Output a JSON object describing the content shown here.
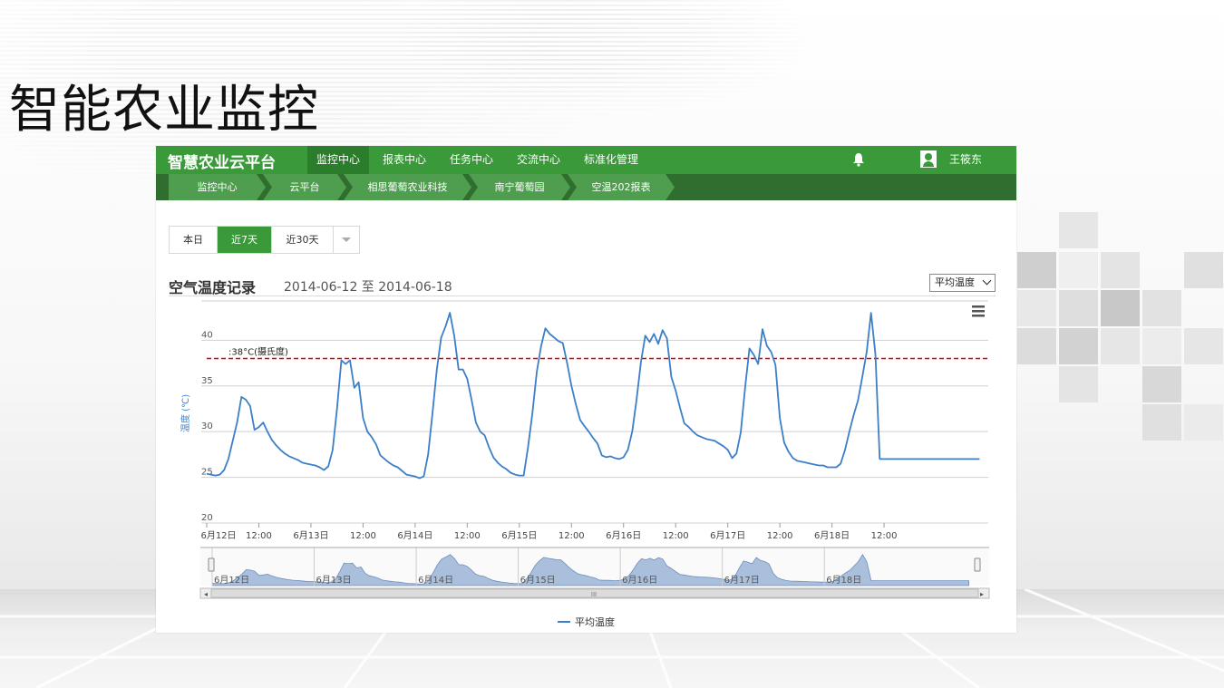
{
  "slide": {
    "title": "智能农业监控"
  },
  "app": {
    "brand": "智慧农业云平台",
    "nav": [
      "监控中心",
      "报表中心",
      "任务中心",
      "交流中心",
      "标准化管理"
    ],
    "nav_active": 0,
    "user": "王筱东",
    "breadcrumbs": [
      "监控中心",
      "云平台",
      "相思葡萄农业科技",
      "南宁葡萄园",
      "空温202报表"
    ],
    "ranges": [
      "本日",
      "近7天",
      "近30天"
    ],
    "range_active": 1,
    "chart_title": "空气温度记录",
    "chart_range": "2014-06-12 至 2014-06-18",
    "metric_select": "平均温度",
    "colors": {
      "nav_green": "#3a9a3a",
      "crumb_dark": "#2f6e2f",
      "line": "#3c7fc8",
      "threshold": "#e00000",
      "navigator_fill": "#a9bfdc"
    }
  },
  "chart_data": {
    "type": "line",
    "ylabel": "温度 (℃)",
    "ylim": [
      20,
      44
    ],
    "yticks": [
      20,
      25,
      30,
      35,
      40
    ],
    "xticks": [
      "6月12日",
      "12:00",
      "6月13日",
      "12:00",
      "6月14日",
      "12:00",
      "6月15日",
      "12:00",
      "6月16日",
      "12:00",
      "6月17日",
      "12:00",
      "6月18日",
      "12:00"
    ],
    "threshold": {
      "value": 38,
      "label": ":38°C(摄氏度)"
    },
    "legend": "平均温度",
    "navigator_labels": [
      "6月12日",
      "6月13日",
      "6月14日",
      "6月15日",
      "6月16日",
      "6月17日",
      "6月18日"
    ],
    "series": [
      {
        "name": "平均温度",
        "hours": [
          0,
          1,
          2,
          3,
          4,
          5,
          6,
          7,
          8,
          9,
          10,
          11,
          12,
          13,
          14,
          15,
          16,
          17,
          18,
          19,
          20,
          21,
          22,
          23,
          24,
          25,
          26,
          27,
          28,
          29,
          30,
          31,
          32,
          33,
          34,
          35,
          36,
          37,
          38,
          39,
          40,
          41,
          42,
          43,
          44,
          45,
          46,
          47,
          48,
          49,
          50,
          51,
          52,
          53,
          54,
          55,
          56,
          57,
          58,
          59,
          60,
          61,
          62,
          63,
          64,
          65,
          66,
          67,
          68,
          69,
          70,
          71,
          72,
          73,
          74,
          75,
          76,
          77,
          78,
          79,
          80,
          81,
          82,
          83,
          84,
          85,
          86,
          87,
          88,
          89,
          90,
          91,
          92,
          93,
          94,
          95,
          96,
          97,
          98,
          99,
          100,
          101,
          102,
          103,
          104,
          105,
          106,
          107,
          108,
          109,
          110,
          111,
          112,
          113,
          114,
          115,
          116,
          117,
          118,
          119,
          120,
          121,
          122,
          123,
          124,
          125,
          126,
          127,
          128,
          129,
          130,
          131,
          132,
          133,
          134,
          135,
          136,
          137,
          138,
          139,
          140,
          141,
          142,
          143,
          144,
          145,
          146,
          147,
          148,
          149,
          150,
          151,
          152,
          153,
          154,
          155,
          156,
          157,
          158,
          159,
          160,
          161,
          162,
          163,
          164,
          165,
          166,
          167,
          168,
          169,
          170,
          171,
          172,
          173,
          174,
          175,
          176,
          177,
          178,
          179
        ],
        "values": [
          25.4,
          25.3,
          25.2,
          25.3,
          25.8,
          27,
          29,
          31,
          33.8,
          33.5,
          32.8,
          30.2,
          30.5,
          31,
          30,
          29.1,
          28.5,
          28,
          27.6,
          27.3,
          27.1,
          26.9,
          26.6,
          26.5,
          26.4,
          26.3,
          26.1,
          25.8,
          26.2,
          28,
          32.5,
          37.8,
          37.4,
          37.8,
          34.8,
          35.4,
          31.5,
          30,
          29.4,
          28.6,
          27.4,
          27,
          26.6,
          26.3,
          26.1,
          25.7,
          25.3,
          25.2,
          25.1,
          24.9,
          25.1,
          27.5,
          32,
          36.8,
          40.3,
          41.5,
          43,
          40.5,
          36.8,
          36.8,
          35.8,
          33.5,
          31,
          30,
          29.6,
          28.3,
          27.2,
          26.6,
          26.2,
          25.9,
          25.5,
          25.3,
          25.2,
          25.2,
          28.3,
          32,
          36.5,
          39.3,
          41.3,
          40.7,
          40.3,
          39.9,
          39.7,
          37.5,
          35,
          33,
          31.3,
          30.6,
          30,
          29.3,
          28.7,
          27.4,
          27.2,
          27.3,
          27.1,
          27,
          27.2,
          28,
          30,
          33.5,
          37.6,
          40.5,
          39.8,
          40.7,
          39.6,
          41.1,
          40.2,
          36,
          34.5,
          32.6,
          30.9,
          30.5,
          30,
          29.6,
          29.4,
          29.2,
          29.1,
          29,
          28.7,
          28.4,
          28,
          27.1,
          27.6,
          29.9,
          34.8,
          39.1,
          38.4,
          37.4,
          41.2,
          39.4,
          38.7,
          37.3,
          31.5,
          28.8,
          27.8,
          27.1,
          26.8,
          26.7,
          26.6,
          26.5,
          26.4,
          26.3,
          26.3,
          26.1,
          26.1,
          26.1,
          26.5,
          28,
          30,
          31.8,
          33.4,
          36,
          38.7,
          43,
          38.5,
          27,
          27,
          27,
          27,
          27,
          27,
          27,
          27,
          27,
          27,
          27,
          27,
          27,
          27,
          27,
          27,
          27,
          27,
          27,
          27,
          27,
          27,
          27,
          27,
          27,
          27,
          27,
          27,
          27,
          27,
          27,
          27,
          27
        ]
      }
    ]
  }
}
